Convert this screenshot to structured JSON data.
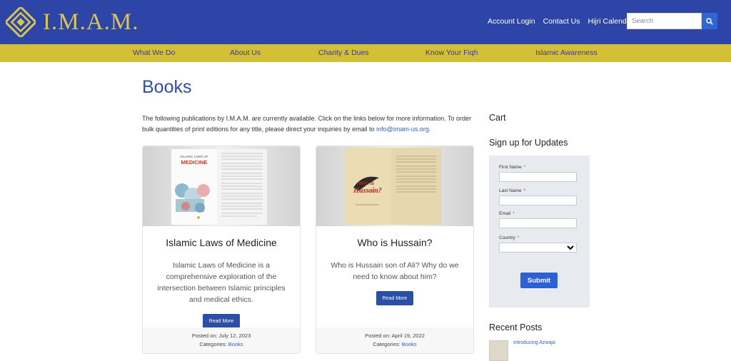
{
  "brand": {
    "name": "I.M.A.M.",
    "logo_color": "#d9c552",
    "header_color": "#2c45a6",
    "nav_color": "#d4c037"
  },
  "top_links": [
    "Account Login",
    "Contact Us",
    "Hijri Calendar"
  ],
  "search": {
    "placeholder": "Search",
    "icon": "search-icon"
  },
  "nav": [
    "What We Do",
    "About Us",
    "Charity & Dues",
    "Know Your Fiqh",
    "Islamic Awareness"
  ],
  "page": {
    "title": "Books",
    "intro_text": "The following publications by I.M.A.M. are currently available. Click on the links below for more information. To order bulk quantities of print editions for any title, please direct your inquiries by email to ",
    "intro_email": "info@imam-us.org",
    "intro_end": "."
  },
  "books": [
    {
      "cover_title_1": "ISLAMIC LAWS OF",
      "cover_title_2": "MEDICINE",
      "title": "Islamic Laws of Medicine",
      "description": "Islamic Laws of Medicine is a comprehensive exploration of the intersection between Islamic principles and medical ethics.",
      "button": "Read More",
      "posted": "Posted on: July 12, 2023",
      "categories_label": "Categories: ",
      "category": "Books"
    },
    {
      "cover_title_1": "WHO IS",
      "cover_title_2": "Hussain?",
      "title": "Who is Hussain?",
      "description": "Who is Hussain son of Ali? Why do we need to know about him?",
      "button": "Read More",
      "posted": "Posted on: April 19, 2022",
      "categories_label": "Categories: ",
      "category": "Books"
    }
  ],
  "sidebar": {
    "cart": "Cart",
    "signup": "Sign up for Updates",
    "form": {
      "first_name": "First Name",
      "last_name": "Last Name",
      "email": "Email",
      "country": "Country",
      "required_mark": "*",
      "submit": "Submit"
    },
    "recent_posts": "Recent Posts",
    "recent_post_title": "Introducing Azwaja"
  }
}
